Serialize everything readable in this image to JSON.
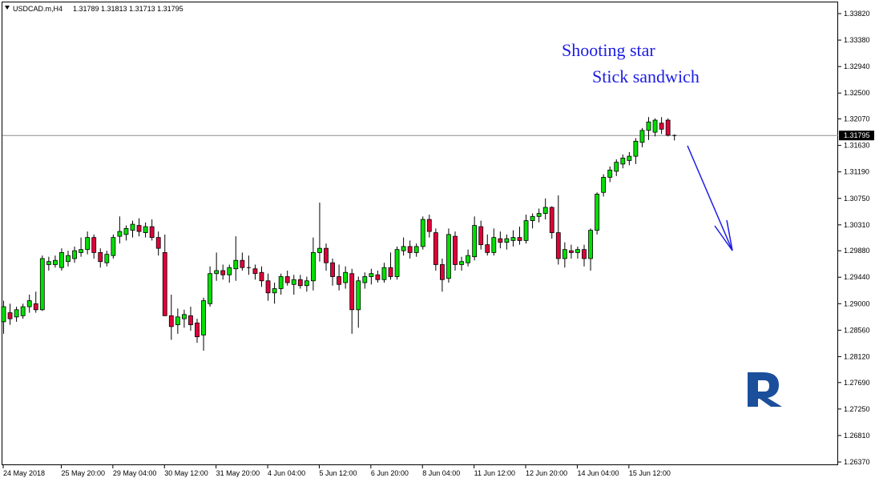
{
  "header": {
    "symbol": "USDCAD.m,H4",
    "ohlc": "1.31789 1.31813 1.31713 1.31795"
  },
  "annotations": {
    "line1": "Shooting star",
    "line2": "Stick sandwich"
  },
  "colors": {
    "bull": "#00e000",
    "bear": "#e0003a",
    "wick": "#000000",
    "annotation": "#1c1ce6",
    "arrow": "#1c1ce6",
    "price_line": "#8a8f8a",
    "logo": "#1b4f9c",
    "price_tag_bg": "#000000",
    "price_tag_text": "#ffffff"
  },
  "logo": {
    "name": "broker-logo-R"
  },
  "chart_data": {
    "type": "candlestick",
    "symbol": "USDCAD",
    "timeframe": "H4",
    "current_price": 1.31795,
    "current_price_label": "1.31795",
    "ylim": [
      1.2637,
      1.3382
    ],
    "y_ticks": [
      "1.33820",
      "1.33380",
      "1.32940",
      "1.32500",
      "1.32070",
      "1.31630",
      "1.31190",
      "1.30750",
      "1.30310",
      "1.29880",
      "1.29440",
      "1.29000",
      "1.28560",
      "1.28120",
      "1.27690",
      "1.27250",
      "1.26810",
      "1.26370"
    ],
    "x_ticks": [
      {
        "label": "24 May 2018",
        "index": 0
      },
      {
        "label": "25 May 20:00",
        "index": 9
      },
      {
        "label": "29 May 04:00",
        "index": 17
      },
      {
        "label": "30 May 12:00",
        "index": 25
      },
      {
        "label": "31 May 20:00",
        "index": 33
      },
      {
        "label": "4 Jun 04:00",
        "index": 41
      },
      {
        "label": "5 Jun 12:00",
        "index": 49
      },
      {
        "label": "6 Jun 20:00",
        "index": 57
      },
      {
        "label": "8 Jun 04:00",
        "index": 65
      },
      {
        "label": "11 Jun 12:00",
        "index": 73
      },
      {
        "label": "12 Jun 20:00",
        "index": 81
      },
      {
        "label": "14 Jun 04:00",
        "index": 89
      },
      {
        "label": "15 Jun 12:00",
        "index": 97
      }
    ],
    "candles": [
      [
        1.287,
        1.2905,
        1.285,
        1.2895
      ],
      [
        1.2885,
        1.29,
        1.2865,
        1.2875
      ],
      [
        1.2878,
        1.2895,
        1.287,
        1.289
      ],
      [
        1.288,
        1.29,
        1.2875,
        1.2895
      ],
      [
        1.2895,
        1.2915,
        1.2885,
        1.2905
      ],
      [
        1.29,
        1.292,
        1.2885,
        1.289
      ],
      [
        1.289,
        1.298,
        1.2888,
        1.2975
      ],
      [
        1.2965,
        1.2978,
        1.2955,
        1.297
      ],
      [
        1.2965,
        1.298,
        1.296,
        1.2972
      ],
      [
        1.296,
        1.2992,
        1.2955,
        1.2985
      ],
      [
        1.297,
        1.2988,
        1.2962,
        1.298
      ],
      [
        1.2975,
        1.2995,
        1.2968,
        1.2988
      ],
      [
        1.2985,
        1.301,
        1.2978,
        1.299
      ],
      [
        1.299,
        1.302,
        1.2982,
        1.301
      ],
      [
        1.301,
        1.3015,
        1.2975,
        1.2985
      ],
      [
        1.2985,
        1.2992,
        1.296,
        1.297
      ],
      [
        1.2968,
        1.2988,
        1.2962,
        1.2982
      ],
      [
        1.298,
        1.3015,
        1.2975,
        1.301
      ],
      [
        1.3012,
        1.3045,
        1.3,
        1.302
      ],
      [
        1.3015,
        1.303,
        1.3005,
        1.3025
      ],
      [
        1.3022,
        1.3038,
        1.301,
        1.3032
      ],
      [
        1.303,
        1.3042,
        1.3012,
        1.302
      ],
      [
        1.3018,
        1.3035,
        1.301,
        1.3028
      ],
      [
        1.3028,
        1.304,
        1.3005,
        1.301
      ],
      [
        1.301,
        1.302,
        1.298,
        1.2992
      ],
      [
        1.2985,
        1.3015,
        1.288,
        1.288
      ],
      [
        1.288,
        1.2915,
        1.284,
        1.2862
      ],
      [
        1.2865,
        1.2892,
        1.285,
        1.2878
      ],
      [
        1.2875,
        1.289,
        1.286,
        1.2882
      ],
      [
        1.288,
        1.2895,
        1.2855,
        1.2865
      ],
      [
        1.2868,
        1.2875,
        1.2835,
        1.2845
      ],
      [
        1.2848,
        1.291,
        1.2822,
        1.2905
      ],
      [
        1.29,
        1.2962,
        1.2895,
        1.295
      ],
      [
        1.295,
        1.2985,
        1.2938,
        1.2955
      ],
      [
        1.2955,
        1.2965,
        1.294,
        1.2948
      ],
      [
        1.2948,
        1.2965,
        1.2935,
        1.296
      ],
      [
        1.2958,
        1.3012,
        1.2938,
        1.2972
      ],
      [
        1.2972,
        1.2985,
        1.2955,
        1.296
      ],
      [
        1.296,
        1.298,
        1.2948,
        1.2958
      ],
      [
        1.2958,
        1.2965,
        1.294,
        1.295
      ],
      [
        1.2952,
        1.2962,
        1.2928,
        1.2938
      ],
      [
        1.2938,
        1.295,
        1.2905,
        1.2918
      ],
      [
        1.2918,
        1.2935,
        1.29,
        1.2925
      ],
      [
        1.2925,
        1.295,
        1.2915,
        1.2945
      ],
      [
        1.2945,
        1.2955,
        1.293,
        1.2935
      ],
      [
        1.2932,
        1.2948,
        1.2915,
        1.294
      ],
      [
        1.294,
        1.2948,
        1.2925,
        1.293
      ],
      [
        1.293,
        1.2945,
        1.292,
        1.2938
      ],
      [
        1.2938,
        1.301,
        1.2922,
        1.2985
      ],
      [
        1.2985,
        1.3068,
        1.297,
        1.2992
      ],
      [
        1.2992,
        1.3,
        1.2955,
        1.2968
      ],
      [
        1.2968,
        1.2975,
        1.293,
        1.2945
      ],
      [
        1.2945,
        1.2965,
        1.2922,
        1.2932
      ],
      [
        1.2935,
        1.2962,
        1.2925,
        1.2952
      ],
      [
        1.295,
        1.2958,
        1.285,
        1.289
      ],
      [
        1.289,
        1.2945,
        1.286,
        1.2938
      ],
      [
        1.2935,
        1.2952,
        1.2925,
        1.2945
      ],
      [
        1.2945,
        1.2958,
        1.2932,
        1.295
      ],
      [
        1.2948,
        1.2955,
        1.2935,
        1.294
      ],
      [
        1.294,
        1.2968,
        1.2935,
        1.296
      ],
      [
        1.296,
        1.2985,
        1.294,
        1.2945
      ],
      [
        1.2945,
        1.2995,
        1.294,
        1.299
      ],
      [
        1.2988,
        1.301,
        1.298,
        1.2995
      ],
      [
        1.2995,
        1.3005,
        1.2975,
        1.2985
      ],
      [
        1.2985,
        1.3,
        1.2978,
        1.2995
      ],
      [
        1.2995,
        1.3045,
        1.299,
        1.304
      ],
      [
        1.304,
        1.3048,
        1.301,
        1.302
      ],
      [
        1.3018,
        1.3025,
        1.2955,
        1.2965
      ],
      [
        1.2965,
        1.2975,
        1.292,
        1.294
      ],
      [
        1.2942,
        1.3025,
        1.2935,
        1.3015
      ],
      [
        1.3012,
        1.302,
        1.2955,
        1.2965
      ],
      [
        1.2965,
        1.2978,
        1.2955,
        1.297
      ],
      [
        1.2968,
        1.299,
        1.2962,
        1.298
      ],
      [
        1.2978,
        1.3045,
        1.2972,
        1.303
      ],
      [
        1.3028,
        1.3038,
        1.299,
        1.2998
      ],
      [
        1.2998,
        1.3015,
        1.298,
        1.2985
      ],
      [
        1.2985,
        1.3025,
        1.298,
        1.301
      ],
      [
        1.3008,
        1.302,
        1.2992,
        1.3002
      ],
      [
        1.3002,
        1.3015,
        1.299,
        1.3008
      ],
      [
        1.3005,
        1.3022,
        1.2995,
        1.301
      ],
      [
        1.301,
        1.3028,
        1.2998,
        1.3005
      ],
      [
        1.3005,
        1.3048,
        1.3,
        1.3038
      ],
      [
        1.3038,
        1.305,
        1.3025,
        1.3045
      ],
      [
        1.3045,
        1.3058,
        1.3035,
        1.305
      ],
      [
        1.305,
        1.3075,
        1.304,
        1.306
      ],
      [
        1.306,
        1.3062,
        1.3008,
        1.3018
      ],
      [
        1.3018,
        1.308,
        1.2965,
        1.2975
      ],
      [
        1.2975,
        1.3002,
        1.296,
        1.299
      ],
      [
        1.2988,
        1.2998,
        1.2975,
        1.2985
      ],
      [
        1.2985,
        1.2995,
        1.2975,
        1.299
      ],
      [
        1.299,
        1.2998,
        1.2962,
        1.2975
      ],
      [
        1.2975,
        1.3025,
        1.2955,
        1.3022
      ],
      [
        1.3022,
        1.3085,
        1.3015,
        1.3082
      ],
      [
        1.3085,
        1.3115,
        1.3078,
        1.311
      ],
      [
        1.311,
        1.3128,
        1.3102,
        1.3122
      ],
      [
        1.312,
        1.314,
        1.3112,
        1.3135
      ],
      [
        1.3132,
        1.3148,
        1.3125,
        1.3142
      ],
      [
        1.3138,
        1.3152,
        1.313,
        1.3145
      ],
      [
        1.3145,
        1.3175,
        1.3132,
        1.317
      ],
      [
        1.3168,
        1.3192,
        1.316,
        1.3188
      ],
      [
        1.3188,
        1.321,
        1.3172,
        1.3202
      ],
      [
        1.3185,
        1.3208,
        1.3178,
        1.3205
      ],
      [
        1.32,
        1.321,
        1.3182,
        1.319
      ],
      [
        1.3205,
        1.3208,
        1.3178,
        1.318
      ],
      [
        1.31789,
        1.31813,
        1.31713,
        1.31795
      ]
    ]
  }
}
